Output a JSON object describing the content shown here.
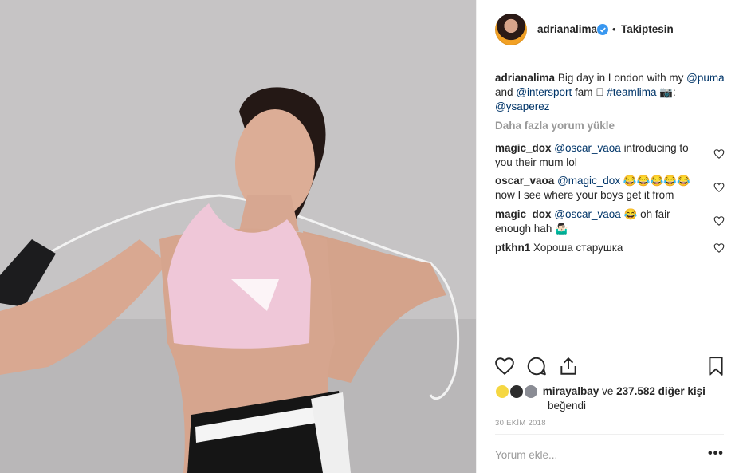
{
  "header": {
    "username": "adrianalima",
    "separator": "•",
    "follow_status": "Takiptesin"
  },
  "caption": {
    "username": "adrianalima",
    "text_1": "Big day in London with my",
    "mention_1": "@puma",
    "text_2": "and",
    "mention_2": "@intersport",
    "text_3": "fam 🏻",
    "hashtag": "#teamlima",
    "text_4": "📷:",
    "mention_3": "@ysaperez"
  },
  "load_more": "Daha fazla yorum yükle",
  "comments": [
    {
      "username": "magic_dox",
      "mention": "@oscar_vaoa",
      "text": "introducing to you their mum lol"
    },
    {
      "username": "oscar_vaoa",
      "mention": "@magic_dox",
      "text": "😂😂😂😂😂 now I see where your boys get it from"
    },
    {
      "username": "magic_dox",
      "mention": "@oscar_vaoa",
      "text": "😂 oh fair enough hah 🤷🏻‍♂️"
    },
    {
      "username": "ptkhn1",
      "mention": "",
      "text": "Хороша старушка"
    }
  ],
  "likes": {
    "user": "mirayalbay",
    "connector": "ve",
    "count_text": "237.582 diğer kişi",
    "suffix": "beğendi"
  },
  "date": "30 EKİM 2018",
  "comment_input": {
    "placeholder": "Yorum ekle..."
  },
  "more_options": "•••",
  "icons": {
    "verified": "verified-badge-icon",
    "like": "heart-icon",
    "comment": "comment-bubble-icon",
    "share": "share-icon",
    "save": "bookmark-icon"
  },
  "colors": {
    "link": "#003569",
    "verified": "#3897f0",
    "muted": "#999999",
    "text": "#262626"
  }
}
